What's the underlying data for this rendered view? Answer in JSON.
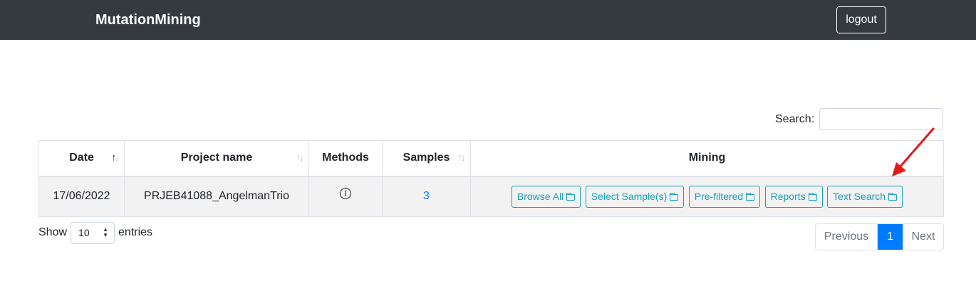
{
  "navbar": {
    "brand": "MutationMining",
    "logout_label": "logout"
  },
  "search": {
    "label": "Search:",
    "value": "",
    "placeholder": ""
  },
  "table": {
    "columns": {
      "date": "Date",
      "project_name": "Project name",
      "methods": "Methods",
      "samples": "Samples",
      "mining": "Mining"
    },
    "rows": [
      {
        "date": "17/06/2022",
        "project_name": "PRJEB41088_AngelmanTrio",
        "methods_icon": "info-icon",
        "samples": "3",
        "mining_buttons": [
          "Browse All",
          "Select Sample(s)",
          "Pre-filtered",
          "Reports",
          "Text Search"
        ]
      }
    ]
  },
  "length": {
    "show": "Show",
    "value": "10",
    "entries": "entries"
  },
  "pagination": {
    "previous": "Previous",
    "current": "1",
    "next": "Next"
  },
  "colors": {
    "navbar_bg": "#343a40",
    "accent": "#007bff",
    "mining_btn": "#17a2b8",
    "annotation_arrow": "#e11b1b"
  }
}
